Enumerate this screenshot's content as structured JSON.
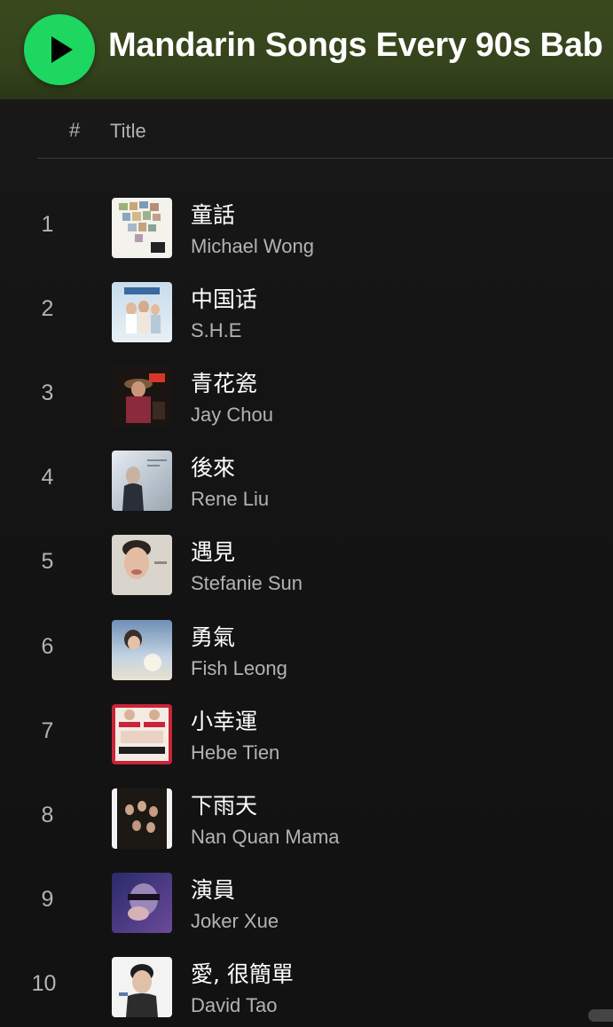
{
  "playlist": {
    "title": "Mandarin Songs Every 90s Bab"
  },
  "columns": {
    "hash": "#",
    "title": "Title"
  },
  "tracks": [
    {
      "number": "1",
      "title": "童話",
      "artist": "Michael Wong"
    },
    {
      "number": "2",
      "title": "中国话",
      "artist": "S.H.E"
    },
    {
      "number": "3",
      "title": "青花瓷",
      "artist": "Jay Chou"
    },
    {
      "number": "4",
      "title": "後來",
      "artist": "Rene Liu"
    },
    {
      "number": "5",
      "title": "遇見",
      "artist": "Stefanie Sun"
    },
    {
      "number": "6",
      "title": "勇氣",
      "artist": "Fish Leong"
    },
    {
      "number": "7",
      "title": "小幸運",
      "artist": "Hebe Tien"
    },
    {
      "number": "8",
      "title": "下雨天",
      "artist": "Nan Quan Mama"
    },
    {
      "number": "9",
      "title": "演員",
      "artist": "Joker Xue"
    },
    {
      "number": "10",
      "title": "愛, 很簡單",
      "artist": "David Tao"
    }
  ],
  "colors": {
    "accent": "#1ed760",
    "header_bg": "#3a4a1e",
    "background": "#121212",
    "text_primary": "#ffffff",
    "text_secondary": "#b3b3b3"
  },
  "icons": {
    "play": "play-icon"
  }
}
